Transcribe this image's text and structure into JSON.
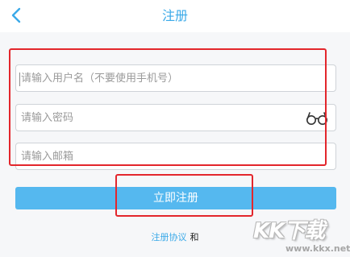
{
  "header": {
    "title": "注册",
    "back_icon": "chevron-left-icon"
  },
  "form": {
    "username": {
      "placeholder": "请输入用户名（不要使用手机号）",
      "value": ""
    },
    "password": {
      "placeholder": "请输入密码",
      "value": "",
      "toggle_icon": "eye-glasses-icon"
    },
    "email": {
      "placeholder": "请输入邮箱",
      "value": ""
    },
    "submit_label": "立即注册"
  },
  "terms": {
    "link_label": "注册协议",
    "and_label": "和"
  },
  "watermark": {
    "logo_text": "KK下载",
    "url": "www.kkx.net"
  },
  "colors": {
    "accent": "#3aa9e8",
    "button": "#55b8ef",
    "annotation": "#e3262c",
    "background": "#f6f7f9"
  }
}
